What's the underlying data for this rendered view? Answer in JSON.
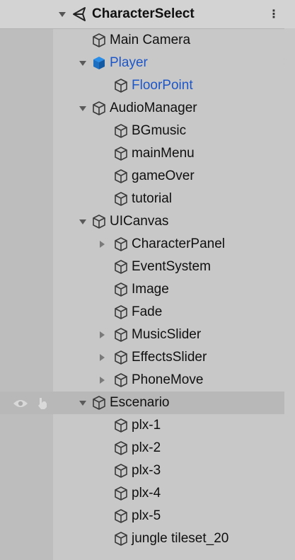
{
  "scene": {
    "title": "CharacterSelect",
    "menu_icon": "kebab-icon"
  },
  "items": [
    {
      "id": "main-camera",
      "label": "Main Camera",
      "depth": 1,
      "expand": "none",
      "icon": "cube-outline-icon",
      "prefab": false
    },
    {
      "id": "player",
      "label": "Player",
      "depth": 1,
      "expand": "expanded",
      "icon": "cube-solid-icon",
      "prefab": true,
      "has_child_arrow": true
    },
    {
      "id": "floorpoint",
      "label": "FloorPoint",
      "depth": 2,
      "expand": "none",
      "icon": "cube-outline-icon",
      "prefab": true
    },
    {
      "id": "audiomanager",
      "label": "AudioManager",
      "depth": 1,
      "expand": "expanded",
      "icon": "cube-outline-icon",
      "prefab": false
    },
    {
      "id": "bgmusic",
      "label": "BGmusic",
      "depth": 2,
      "expand": "none",
      "icon": "cube-outline-icon",
      "prefab": false
    },
    {
      "id": "mainmenu",
      "label": "mainMenu",
      "depth": 2,
      "expand": "none",
      "icon": "cube-outline-icon",
      "prefab": false
    },
    {
      "id": "gameover",
      "label": "gameOver",
      "depth": 2,
      "expand": "none",
      "icon": "cube-outline-icon",
      "prefab": false
    },
    {
      "id": "tutorial",
      "label": "tutorial",
      "depth": 2,
      "expand": "none",
      "icon": "cube-outline-icon",
      "prefab": false
    },
    {
      "id": "uicanvas",
      "label": "UICanvas",
      "depth": 1,
      "expand": "expanded",
      "icon": "cube-outline-icon",
      "prefab": false
    },
    {
      "id": "characterpanel",
      "label": "CharacterPanel",
      "depth": 2,
      "expand": "collapsed",
      "icon": "cube-outline-icon",
      "prefab": false
    },
    {
      "id": "eventsystem",
      "label": "EventSystem",
      "depth": 2,
      "expand": "none",
      "icon": "cube-outline-icon",
      "prefab": false
    },
    {
      "id": "image",
      "label": "Image",
      "depth": 2,
      "expand": "none",
      "icon": "cube-outline-icon",
      "prefab": false
    },
    {
      "id": "fade",
      "label": "Fade",
      "depth": 2,
      "expand": "none",
      "icon": "cube-outline-icon",
      "prefab": false
    },
    {
      "id": "musicslider",
      "label": "MusicSlider",
      "depth": 2,
      "expand": "collapsed",
      "icon": "cube-outline-icon",
      "prefab": false
    },
    {
      "id": "effectsslider",
      "label": "EffectsSlider",
      "depth": 2,
      "expand": "collapsed",
      "icon": "cube-outline-icon",
      "prefab": false
    },
    {
      "id": "phonemove",
      "label": "PhoneMove",
      "depth": 2,
      "expand": "collapsed",
      "icon": "cube-outline-icon",
      "prefab": false
    },
    {
      "id": "escenario",
      "label": "Escenario",
      "depth": 1,
      "expand": "expanded",
      "icon": "cube-outline-icon",
      "prefab": false,
      "highlighted": true,
      "gutter_icons": [
        "eye-icon",
        "hand-pointer-icon"
      ]
    },
    {
      "id": "plx-1",
      "label": "plx-1",
      "depth": 2,
      "expand": "none",
      "icon": "cube-outline-icon",
      "prefab": false
    },
    {
      "id": "plx-2",
      "label": "plx-2",
      "depth": 2,
      "expand": "none",
      "icon": "cube-outline-icon",
      "prefab": false
    },
    {
      "id": "plx-3",
      "label": "plx-3",
      "depth": 2,
      "expand": "none",
      "icon": "cube-outline-icon",
      "prefab": false
    },
    {
      "id": "plx-4",
      "label": "plx-4",
      "depth": 2,
      "expand": "none",
      "icon": "cube-outline-icon",
      "prefab": false
    },
    {
      "id": "plx-5",
      "label": "plx-5",
      "depth": 2,
      "expand": "none",
      "icon": "cube-outline-icon",
      "prefab": false
    },
    {
      "id": "jungle-tileset",
      "label": "jungle tileset_20",
      "depth": 2,
      "expand": "none",
      "icon": "cube-outline-icon",
      "prefab": false
    }
  ],
  "colors": {
    "prefab_text": "#1d56c8",
    "prefab_icon": "#2a8de8"
  }
}
